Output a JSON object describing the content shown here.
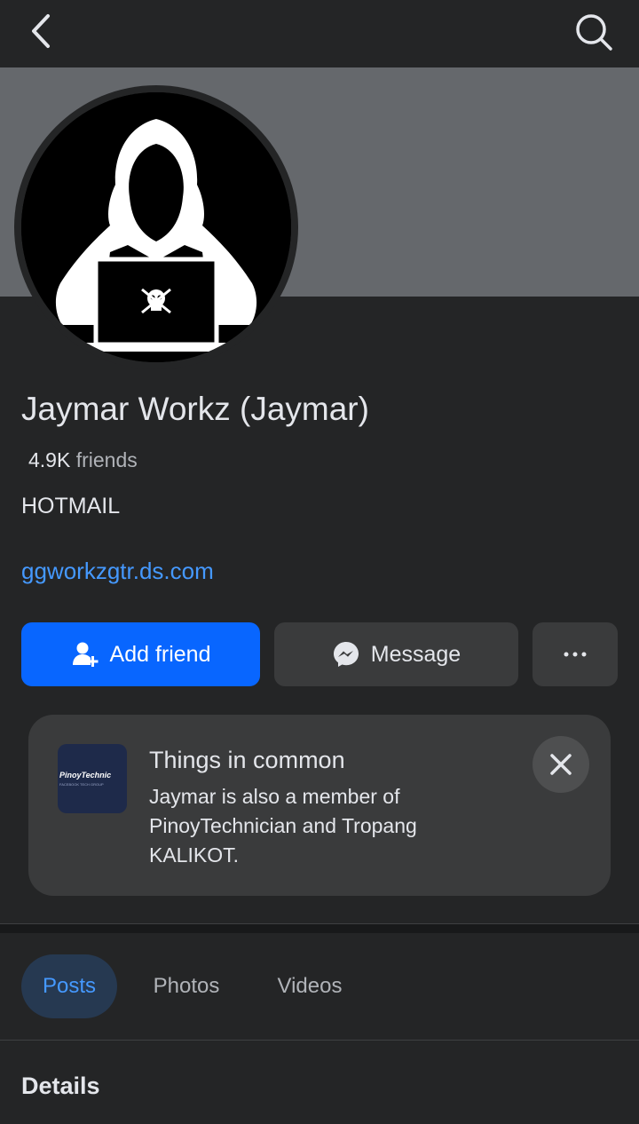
{
  "header": {
    "back_icon": "chevron-left-icon",
    "search_icon": "search-icon"
  },
  "profile": {
    "name": "Jaymar Workz (Jaymar)",
    "friends_count": "4.9K",
    "friends_label": "friends",
    "bio": "HOTMAIL",
    "website": "ggworkzgtr.ds.com"
  },
  "actions": {
    "add_friend": "Add friend",
    "message": "Message"
  },
  "common": {
    "title": "Things in common",
    "desc_prefix": "Jaymar is also a member of ",
    "group1": "PinoyTechnician",
    "conj": " and ",
    "group2": "Tropang KALIKOT",
    "suffix": ".",
    "thumb_title": "PinoyTechnic",
    "thumb_sub": "FACEBOOK TECH GROUP"
  },
  "tabs": [
    "Posts",
    "Photos",
    "Videos"
  ],
  "section": {
    "details": "Details"
  },
  "colors": {
    "background": "#242526",
    "cover": "#65686c",
    "primary": "#0866ff",
    "link": "#4599ff",
    "secondary_button": "#3a3b3c"
  }
}
